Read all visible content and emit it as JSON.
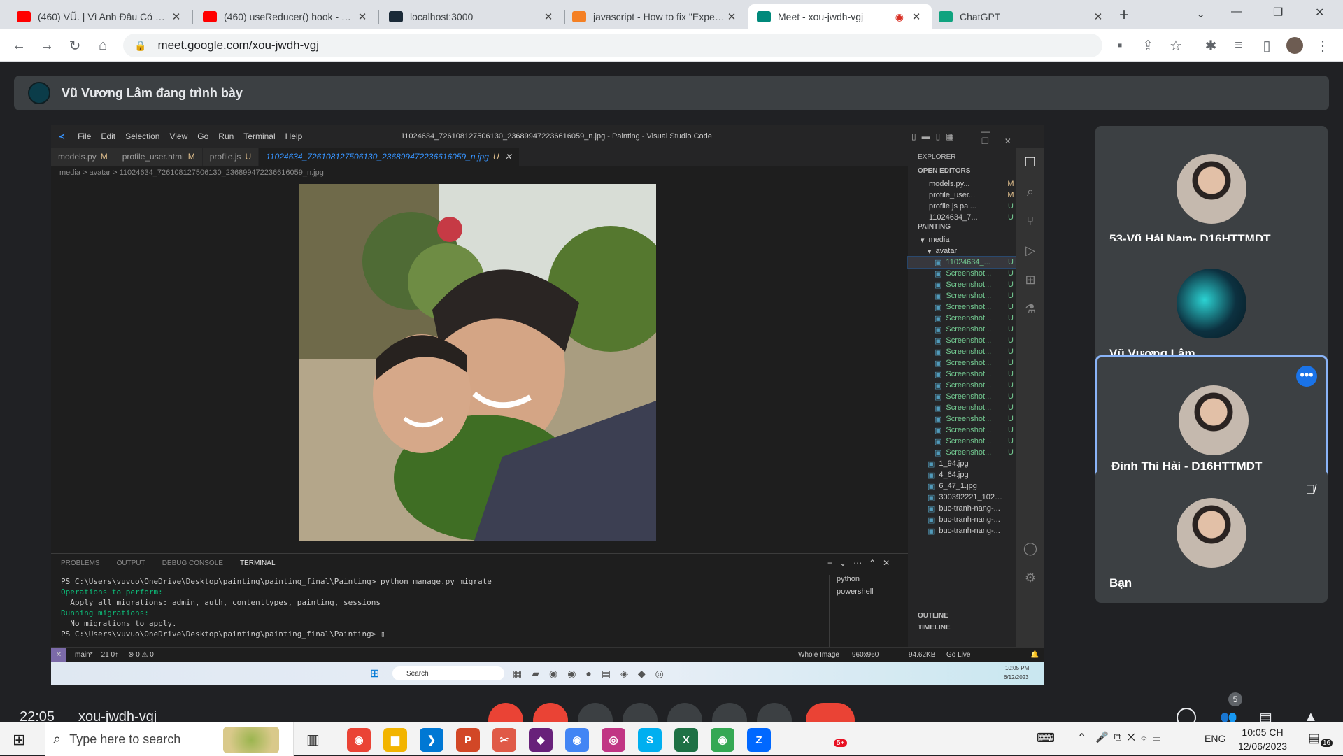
{
  "browser": {
    "tabs": [
      {
        "title": "(460) VŨ. | Vì Anh Đâu Có Biết",
        "favicon": "youtube-icon",
        "color": "#ff0000"
      },
      {
        "title": "(460) useReducer() hook - YouTube",
        "favicon": "youtube-icon",
        "color": "#ff0000"
      },
      {
        "title": "localhost:3000",
        "favicon": "react-icon",
        "color": "#1b2a38"
      },
      {
        "title": "javascript - How to fix \"Expected\"",
        "favicon": "stackoverflow-icon",
        "color": "#f48024"
      },
      {
        "title": "Meet - xou-jwdh-vgj",
        "favicon": "meet-icon",
        "color": "#00897b",
        "active": true
      },
      {
        "title": "ChatGPT",
        "favicon": "chatgpt-icon",
        "color": "#10a37f"
      }
    ],
    "new_tab": "+",
    "url": "meet.google.com/xou-jwdh-vgj",
    "window_controls": [
      "—",
      "❐",
      "✕"
    ]
  },
  "meet": {
    "presenting_banner": "Vũ Vương Lâm đang trình bày",
    "participants": [
      {
        "name": "53-Vũ Hải Nam- D16HTTMDT",
        "avatar": "photo",
        "active": false,
        "muted": false
      },
      {
        "name": "Vũ Vương Lâm",
        "avatar": "planet-logo",
        "active": false,
        "muted": false
      },
      {
        "name": "Đinh Thị Hải - D16HTTMDT",
        "avatar": "photo",
        "active": true,
        "muted": false,
        "has_menu": true
      },
      {
        "name": "Bạn",
        "avatar": "photo",
        "active": false,
        "muted": true
      }
    ],
    "bottom": {
      "time": "22:05",
      "meeting_code": "xou-jwdh-vgj",
      "people_count": "5"
    }
  },
  "vscode": {
    "title": "11024634_726108127506130_236899472236616059_n.jpg - Painting - Visual Studio Code",
    "menu": [
      "File",
      "Edit",
      "Selection",
      "View",
      "Go",
      "Run",
      "Terminal",
      "Help"
    ],
    "tabs": [
      {
        "label": "models.py",
        "status": "M"
      },
      {
        "label": "profile_user.html",
        "status": "M"
      },
      {
        "label": "profile.js",
        "status": "U"
      },
      {
        "label": "11024634_726108127506130_236899472236616059_n.jpg",
        "status": "U",
        "active": true
      }
    ],
    "breadcrumb": "media > avatar > 11024634_726108127506130_236899472236616059_n.jpg",
    "panel_tabs": [
      "PROBLEMS",
      "OUTPUT",
      "DEBUG CONSOLE",
      "TERMINAL"
    ],
    "terminal": [
      {
        "text": "PS C:\\Users\\vuvuo\\OneDrive\\Desktop\\painting\\painting_final\\Painting> python manage.py migrate",
        "cls": ""
      },
      {
        "text": "Operations to perform:",
        "cls": "g"
      },
      {
        "text": "  Apply all migrations: admin, auth, contenttypes, painting, sessions",
        "cls": ""
      },
      {
        "text": "Running migrations:",
        "cls": "g"
      },
      {
        "text": "  No migrations to apply.",
        "cls": ""
      },
      {
        "text": "PS C:\\Users\\vuvuo\\OneDrive\\Desktop\\painting\\painting_final\\Painting> ▯",
        "cls": ""
      }
    ],
    "shells": [
      "python",
      "powershell"
    ],
    "explorer": {
      "header": "EXPLORER",
      "open_editors_label": "OPEN EDITORS",
      "open_editors": [
        {
          "name": "models.py...",
          "st": "M"
        },
        {
          "name": "profile_user...",
          "st": "M"
        },
        {
          "name": "profile.js pai...",
          "st": "U"
        },
        {
          "name": "11024634_7...",
          "st": "U"
        }
      ],
      "project_label": "PAINTING",
      "tree": [
        {
          "name": "media",
          "st": "",
          "depth": 1
        },
        {
          "name": "avatar",
          "st": "",
          "depth": 2
        },
        {
          "name": "11024634_...",
          "st": "U",
          "depth": 3,
          "selected": true
        },
        {
          "name": "Screenshot...",
          "st": "U",
          "depth": 3
        },
        {
          "name": "Screenshot...",
          "st": "U",
          "depth": 3
        },
        {
          "name": "Screenshot...",
          "st": "U",
          "depth": 3
        },
        {
          "name": "Screenshot...",
          "st": "U",
          "depth": 3
        },
        {
          "name": "Screenshot...",
          "st": "U",
          "depth": 3
        },
        {
          "name": "Screenshot...",
          "st": "U",
          "depth": 3
        },
        {
          "name": "Screenshot...",
          "st": "U",
          "depth": 3
        },
        {
          "name": "Screenshot...",
          "st": "U",
          "depth": 3
        },
        {
          "name": "Screenshot...",
          "st": "U",
          "depth": 3
        },
        {
          "name": "Screenshot...",
          "st": "U",
          "depth": 3
        },
        {
          "name": "Screenshot...",
          "st": "U",
          "depth": 3
        },
        {
          "name": "Screenshot...",
          "st": "U",
          "depth": 3
        },
        {
          "name": "Screenshot...",
          "st": "U",
          "depth": 3
        },
        {
          "name": "Screenshot...",
          "st": "U",
          "depth": 3
        },
        {
          "name": "Screenshot...",
          "st": "U",
          "depth": 3
        },
        {
          "name": "Screenshot...",
          "st": "U",
          "depth": 3
        },
        {
          "name": "Screenshot...",
          "st": "U",
          "depth": 3
        },
        {
          "name": "1_94.jpg",
          "st": "",
          "depth": 2
        },
        {
          "name": "4_64.jpg",
          "st": "",
          "depth": 2
        },
        {
          "name": "6_47_1.jpg",
          "st": "",
          "depth": 2
        },
        {
          "name": "300392221_1023...",
          "st": "",
          "depth": 2
        },
        {
          "name": "buc-tranh-nang-...",
          "st": "",
          "depth": 2
        },
        {
          "name": "buc-tranh-nang-...",
          "st": "",
          "depth": 2
        },
        {
          "name": "buc-tranh-nang-...",
          "st": "",
          "depth": 2
        }
      ],
      "outline_label": "OUTLINE",
      "timeline_label": "TIMELINE"
    },
    "statusbar": {
      "branch": "main*",
      "sync": "21 0↑",
      "problems": "⊗ 0 ⚠ 0",
      "image_mode": "Whole Image",
      "dimensions": "960x960",
      "size": "94.62KB",
      "golive": "Go Live"
    },
    "win_taskbar": {
      "search": "Search",
      "time": "10:05 PM",
      "date": "6/12/2023"
    }
  },
  "taskbar": {
    "search_placeholder": "Type here to search",
    "apps": [
      {
        "name": "chrome-icon",
        "color": "#ea4335",
        "glyph": "◉"
      },
      {
        "name": "file-explorer-icon",
        "color": "#f2b400",
        "glyph": "▆"
      },
      {
        "name": "vscode-icon",
        "color": "#0078d4",
        "glyph": "❯"
      },
      {
        "name": "powerpoint-icon",
        "color": "#d24726",
        "glyph": "P"
      },
      {
        "name": "snip-icon",
        "color": "#e05a47",
        "glyph": "✂"
      },
      {
        "name": "visual-studio-icon",
        "color": "#68217a",
        "glyph": "◆"
      },
      {
        "name": "chrome-alt-icon",
        "color": "#4285f4",
        "glyph": "◉"
      },
      {
        "name": "instagram-icon",
        "color": "#c13584",
        "glyph": "◎"
      },
      {
        "name": "skype-icon",
        "color": "#00aff0",
        "glyph": "S"
      },
      {
        "name": "excel-icon",
        "color": "#1e7145",
        "glyph": "X"
      },
      {
        "name": "chrome-profile-icon",
        "color": "#34a853",
        "glyph": "◉"
      },
      {
        "name": "zalo-icon",
        "color": "#0068ff",
        "glyph": "Z"
      }
    ],
    "zalo_badge": "5+",
    "lang": "ENG",
    "time": "10:05 CH",
    "date": "12/06/2023",
    "notifications": "16"
  }
}
